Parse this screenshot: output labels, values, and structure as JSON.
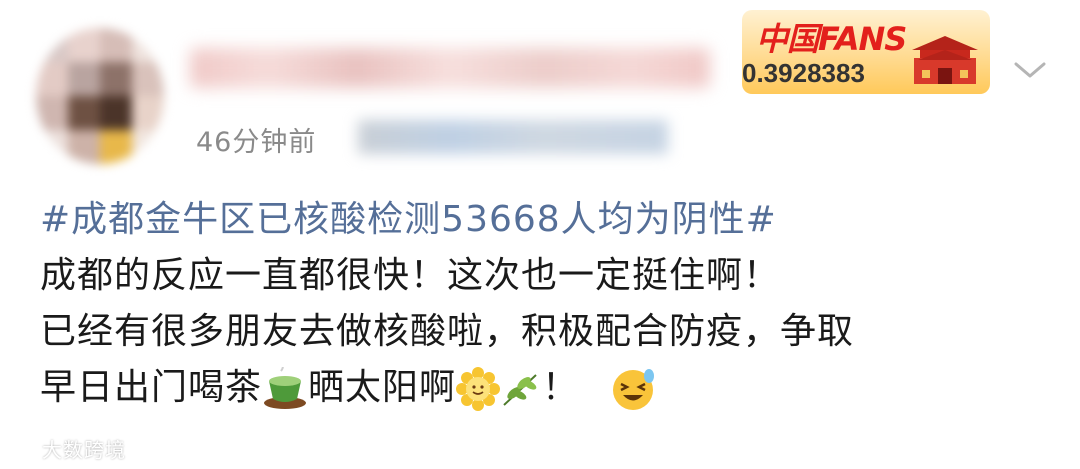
{
  "post": {
    "time": "46分钟前",
    "hashtag": "#成都金牛区已核酸检测53668人均为阴性#",
    "lines": [
      "成都的反应一直都很快！这次也一定挺住啊！",
      "已经有很多朋友去做核酸啦，积极配合防疫，争取",
      "早日出门喝茶",
      "晒太阳啊",
      "！"
    ]
  },
  "badge": {
    "title": "中国FANS",
    "id": "0.3928383"
  },
  "watermark": "大数跨境",
  "icons": {
    "tea": "tea-cup-icon",
    "sun": "sun-flower-icon",
    "leaf": "leaf-icon",
    "face": "laughing-face-icon",
    "chevron": "chevron-down-icon"
  },
  "colors": {
    "hashtag": "#556f98",
    "badge_red": "#e3201c"
  }
}
